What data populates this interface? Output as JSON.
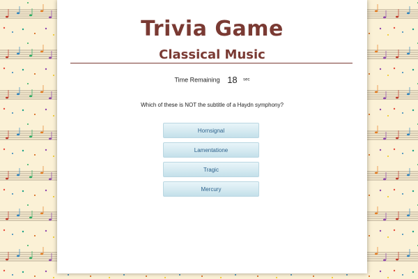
{
  "game": {
    "title": "Trivia Game",
    "category": "Classical Music",
    "timer_label": "Time Remaining",
    "timer_value": "18",
    "timer_unit": "sec",
    "question": "Which of these is NOT the subtitle of a Haydn symphony?",
    "answers": [
      "Hornsignal",
      "Lamentatione",
      "Tragic",
      "Mercury"
    ]
  },
  "colors": {
    "title": "#7a3a33",
    "background": "#fbf1d6",
    "answer_text": "#2a5f8a",
    "answer_border": "#b9d7e2"
  },
  "icons": [
    "music-staff-background-pattern"
  ]
}
